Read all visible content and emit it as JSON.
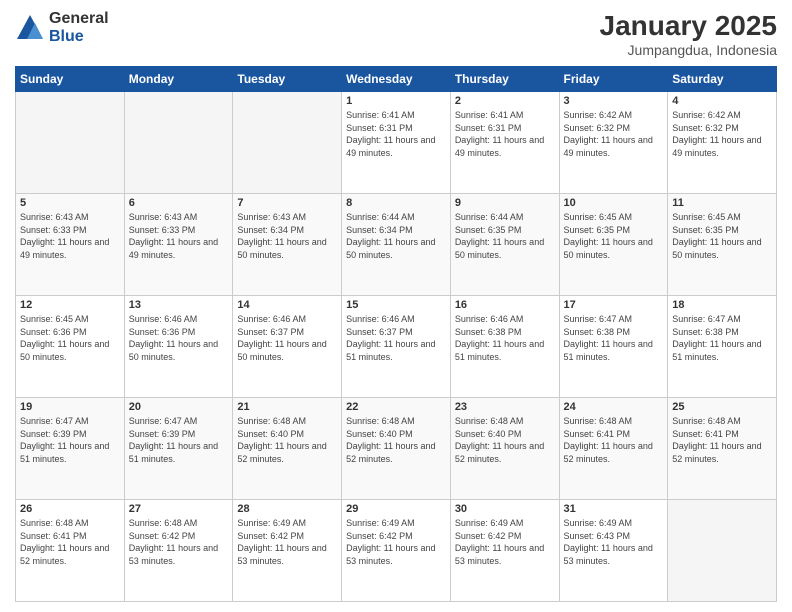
{
  "logo": {
    "general": "General",
    "blue": "Blue"
  },
  "header": {
    "month": "January 2025",
    "location": "Jumpangdua, Indonesia"
  },
  "weekdays": [
    "Sunday",
    "Monday",
    "Tuesday",
    "Wednesday",
    "Thursday",
    "Friday",
    "Saturday"
  ],
  "weeks": [
    [
      {
        "day": "",
        "info": ""
      },
      {
        "day": "",
        "info": ""
      },
      {
        "day": "",
        "info": ""
      },
      {
        "day": "1",
        "info": "Sunrise: 6:41 AM\nSunset: 6:31 PM\nDaylight: 11 hours and 49 minutes."
      },
      {
        "day": "2",
        "info": "Sunrise: 6:41 AM\nSunset: 6:31 PM\nDaylight: 11 hours and 49 minutes."
      },
      {
        "day": "3",
        "info": "Sunrise: 6:42 AM\nSunset: 6:32 PM\nDaylight: 11 hours and 49 minutes."
      },
      {
        "day": "4",
        "info": "Sunrise: 6:42 AM\nSunset: 6:32 PM\nDaylight: 11 hours and 49 minutes."
      }
    ],
    [
      {
        "day": "5",
        "info": "Sunrise: 6:43 AM\nSunset: 6:33 PM\nDaylight: 11 hours and 49 minutes."
      },
      {
        "day": "6",
        "info": "Sunrise: 6:43 AM\nSunset: 6:33 PM\nDaylight: 11 hours and 49 minutes."
      },
      {
        "day": "7",
        "info": "Sunrise: 6:43 AM\nSunset: 6:34 PM\nDaylight: 11 hours and 50 minutes."
      },
      {
        "day": "8",
        "info": "Sunrise: 6:44 AM\nSunset: 6:34 PM\nDaylight: 11 hours and 50 minutes."
      },
      {
        "day": "9",
        "info": "Sunrise: 6:44 AM\nSunset: 6:35 PM\nDaylight: 11 hours and 50 minutes."
      },
      {
        "day": "10",
        "info": "Sunrise: 6:45 AM\nSunset: 6:35 PM\nDaylight: 11 hours and 50 minutes."
      },
      {
        "day": "11",
        "info": "Sunrise: 6:45 AM\nSunset: 6:35 PM\nDaylight: 11 hours and 50 minutes."
      }
    ],
    [
      {
        "day": "12",
        "info": "Sunrise: 6:45 AM\nSunset: 6:36 PM\nDaylight: 11 hours and 50 minutes."
      },
      {
        "day": "13",
        "info": "Sunrise: 6:46 AM\nSunset: 6:36 PM\nDaylight: 11 hours and 50 minutes."
      },
      {
        "day": "14",
        "info": "Sunrise: 6:46 AM\nSunset: 6:37 PM\nDaylight: 11 hours and 50 minutes."
      },
      {
        "day": "15",
        "info": "Sunrise: 6:46 AM\nSunset: 6:37 PM\nDaylight: 11 hours and 51 minutes."
      },
      {
        "day": "16",
        "info": "Sunrise: 6:46 AM\nSunset: 6:38 PM\nDaylight: 11 hours and 51 minutes."
      },
      {
        "day": "17",
        "info": "Sunrise: 6:47 AM\nSunset: 6:38 PM\nDaylight: 11 hours and 51 minutes."
      },
      {
        "day": "18",
        "info": "Sunrise: 6:47 AM\nSunset: 6:38 PM\nDaylight: 11 hours and 51 minutes."
      }
    ],
    [
      {
        "day": "19",
        "info": "Sunrise: 6:47 AM\nSunset: 6:39 PM\nDaylight: 11 hours and 51 minutes."
      },
      {
        "day": "20",
        "info": "Sunrise: 6:47 AM\nSunset: 6:39 PM\nDaylight: 11 hours and 51 minutes."
      },
      {
        "day": "21",
        "info": "Sunrise: 6:48 AM\nSunset: 6:40 PM\nDaylight: 11 hours and 52 minutes."
      },
      {
        "day": "22",
        "info": "Sunrise: 6:48 AM\nSunset: 6:40 PM\nDaylight: 11 hours and 52 minutes."
      },
      {
        "day": "23",
        "info": "Sunrise: 6:48 AM\nSunset: 6:40 PM\nDaylight: 11 hours and 52 minutes."
      },
      {
        "day": "24",
        "info": "Sunrise: 6:48 AM\nSunset: 6:41 PM\nDaylight: 11 hours and 52 minutes."
      },
      {
        "day": "25",
        "info": "Sunrise: 6:48 AM\nSunset: 6:41 PM\nDaylight: 11 hours and 52 minutes."
      }
    ],
    [
      {
        "day": "26",
        "info": "Sunrise: 6:48 AM\nSunset: 6:41 PM\nDaylight: 11 hours and 52 minutes."
      },
      {
        "day": "27",
        "info": "Sunrise: 6:48 AM\nSunset: 6:42 PM\nDaylight: 11 hours and 53 minutes."
      },
      {
        "day": "28",
        "info": "Sunrise: 6:49 AM\nSunset: 6:42 PM\nDaylight: 11 hours and 53 minutes."
      },
      {
        "day": "29",
        "info": "Sunrise: 6:49 AM\nSunset: 6:42 PM\nDaylight: 11 hours and 53 minutes."
      },
      {
        "day": "30",
        "info": "Sunrise: 6:49 AM\nSunset: 6:42 PM\nDaylight: 11 hours and 53 minutes."
      },
      {
        "day": "31",
        "info": "Sunrise: 6:49 AM\nSunset: 6:43 PM\nDaylight: 11 hours and 53 minutes."
      },
      {
        "day": "",
        "info": ""
      }
    ]
  ]
}
